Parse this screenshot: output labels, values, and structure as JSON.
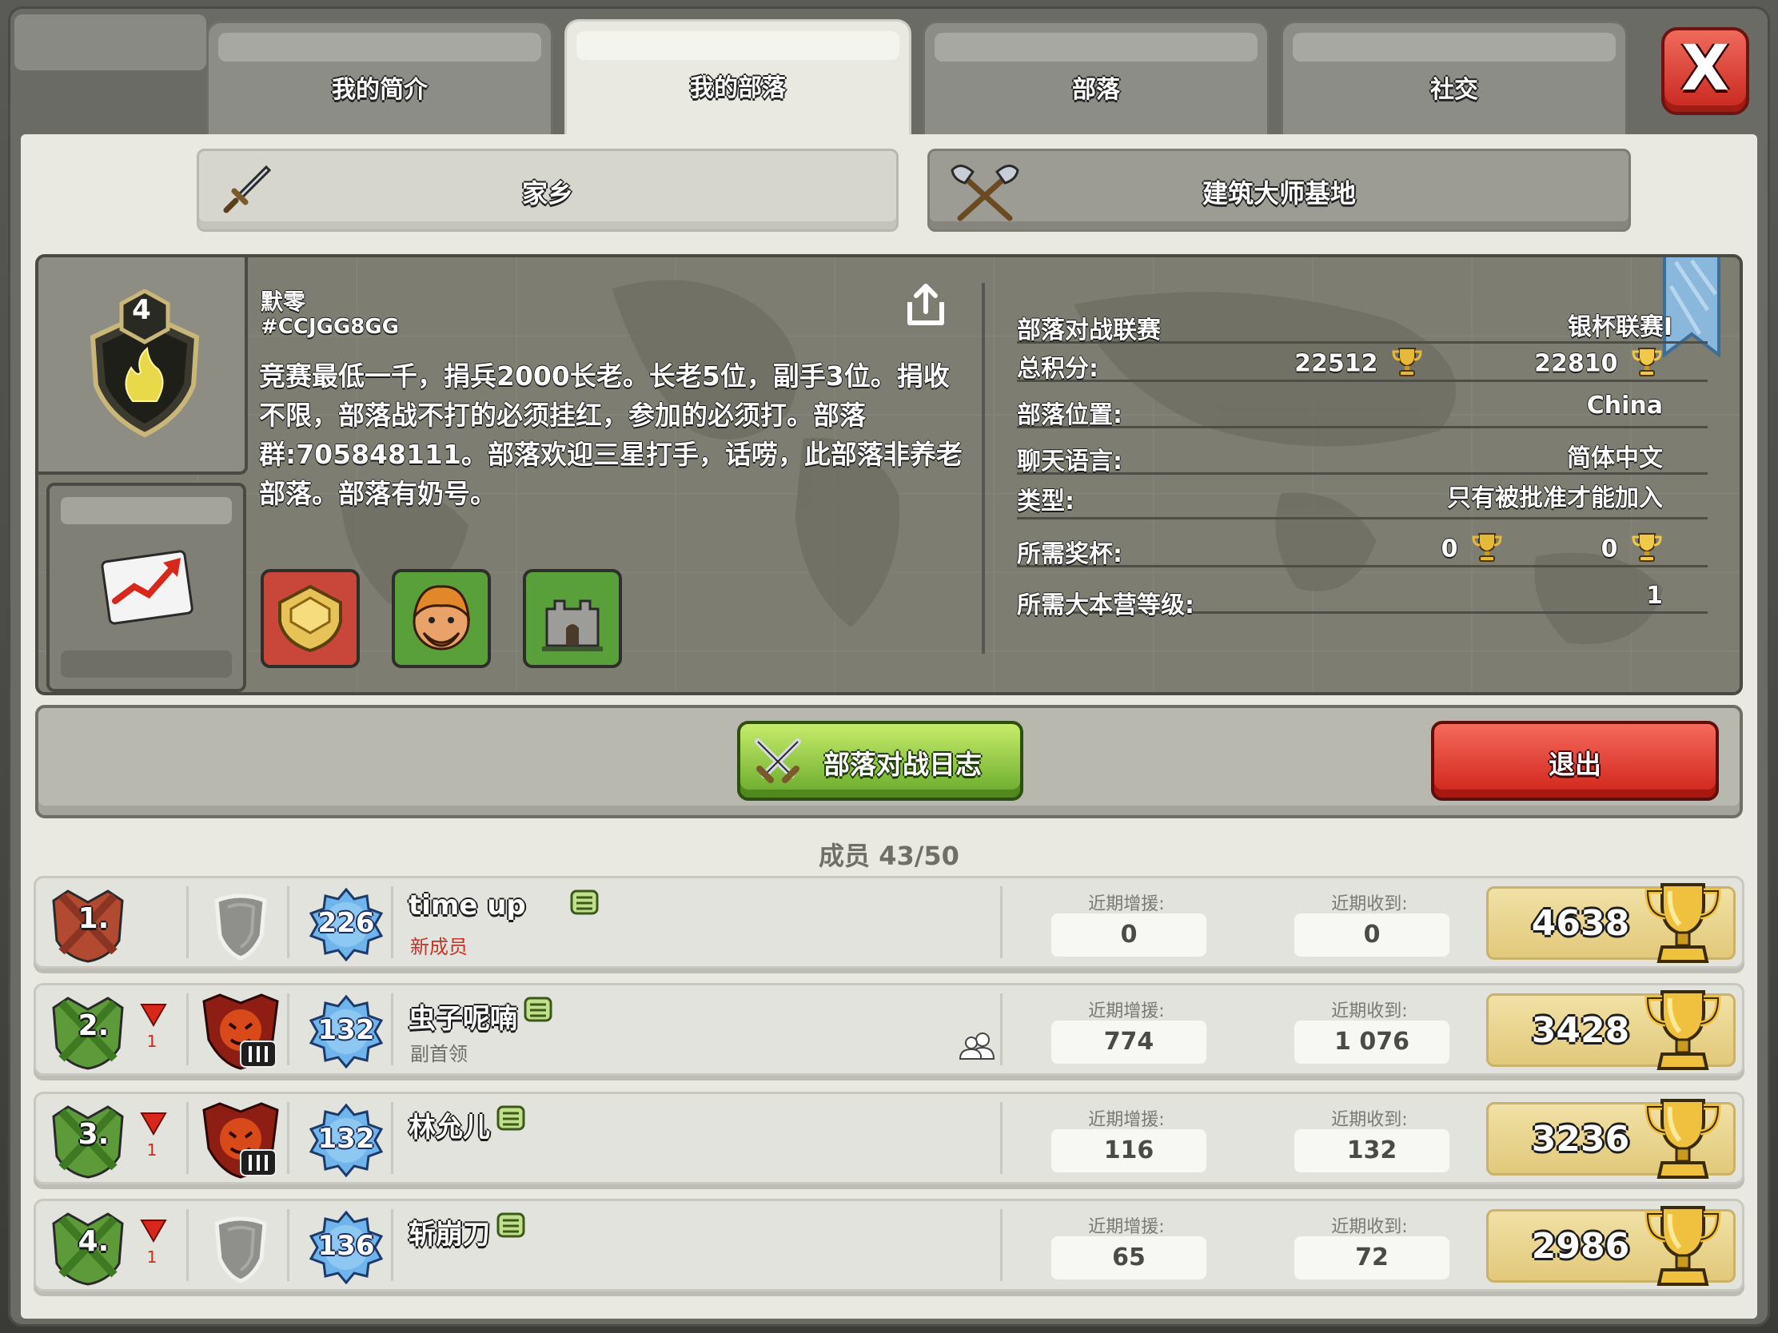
{
  "tabs": [
    {
      "label": "我的简介"
    },
    {
      "label": "我的部落"
    },
    {
      "label": "部落"
    },
    {
      "label": "社交"
    }
  ],
  "close_label": "X",
  "bases": {
    "home": "家乡",
    "builder": "建筑大师基地"
  },
  "clan": {
    "level": "4",
    "name": "默零",
    "tag": "#CCJGG8GG",
    "description": "竞赛最低一千，捐兵2000长老。长老5位，副手3位。捐收不限，部落战不打的必须挂红，参加的必须打。部落群:705848111。部落欢迎三星打手，话唠，此部落非养老部落。部落有奶号。"
  },
  "info": {
    "war_league_label": "部落对战联赛",
    "war_league_value": "银杯联赛I",
    "total_points_label": "总积分:",
    "total_points_home": "22512",
    "total_points_builder": "22810",
    "location_label": "部落位置:",
    "location_value": "China",
    "language_label": "聊天语言:",
    "language_value": "简体中文",
    "type_label": "类型:",
    "type_value": "只有被批准才能加入",
    "required_trophies_label": "所需奖杯:",
    "required_trophies_home": "0",
    "required_trophies_builder": "0",
    "required_th_label": "所需大本营等级:",
    "required_th_value": "1"
  },
  "actions": {
    "war_log": "部落对战日志",
    "leave": "退出"
  },
  "members_count": "成员 43/50",
  "member_labels": {
    "donated": "近期增援:",
    "received": "近期收到:"
  },
  "members": [
    {
      "rank": "1.",
      "trend": "",
      "xp": "226",
      "name": "time up",
      "role": "新成员",
      "donated": "0",
      "received": "0",
      "trophies": "4638"
    },
    {
      "rank": "2.",
      "trend": "1",
      "xp": "132",
      "name": "虫子呢喃",
      "role": "副首领",
      "donated": "774",
      "received": "1 076",
      "trophies": "3428"
    },
    {
      "rank": "3.",
      "trend": "1",
      "xp": "132",
      "name": "林允儿",
      "role": "",
      "donated": "116",
      "received": "132",
      "trophies": "3236"
    },
    {
      "rank": "4.",
      "trend": "1",
      "xp": "136",
      "name": "斩崩刀",
      "role": "",
      "donated": "65",
      "received": "72",
      "trophies": "2986"
    }
  ],
  "colors": {
    "panel": "#e9e9e2",
    "tab_inactive": "#8d8d87",
    "green_button": "#67a82a",
    "red_button": "#cf2217",
    "trophy_gold": "#e2c97a",
    "role_new_member": "#c3342a",
    "role_default": "#6f6f68"
  }
}
